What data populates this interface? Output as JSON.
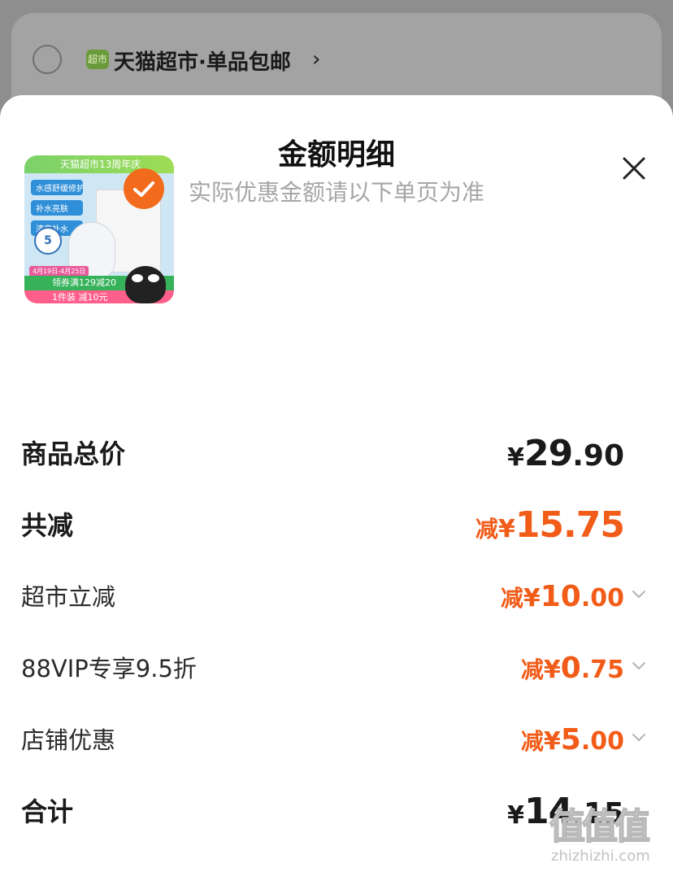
{
  "store": {
    "logo_text": "超市",
    "name": "天猫超市·单品包邮",
    "chevron": "›"
  },
  "sheet": {
    "title": "金额明细",
    "subtitle": "实际优惠金额请以下单页为准",
    "close_icon": "close-icon"
  },
  "product": {
    "banner": "天猫超市13周年庆",
    "tags": [
      "水感舒缓修护",
      "补水亮肤",
      "清爽补水"
    ],
    "pack_count": "5",
    "date": "4月19日-4月25日",
    "promo1": "领券满129减20",
    "promo2": "1件装 减10元",
    "selected": true
  },
  "price_rows": [
    {
      "label": "商品总价",
      "prefix": "",
      "yen": "¥",
      "int": "29",
      "dec": ".90",
      "style": "total"
    },
    {
      "label": "共减",
      "prefix": "减",
      "yen": "¥",
      "int": "15",
      "dec": ".75",
      "style": "total-discount"
    },
    {
      "label": "超市立减",
      "prefix": "减",
      "yen": "¥",
      "int": "10",
      "dec": ".00",
      "style": "discount",
      "expandable": true
    },
    {
      "label": "88VIP专享9.5折",
      "prefix": "减",
      "yen": "¥",
      "int": "0",
      "dec": ".75",
      "style": "discount",
      "expandable": true
    },
    {
      "label": "店铺优惠",
      "prefix": "减",
      "yen": "¥",
      "int": "5",
      "dec": ".00",
      "style": "discount",
      "expandable": true
    },
    {
      "label": "合计",
      "prefix": "",
      "yen": "¥",
      "int": "14",
      "dec": ".15",
      "style": "total"
    }
  ],
  "watermark": {
    "logo": "值值值",
    "url": "zhizhizhi.com"
  },
  "colors": {
    "accent": "#f25c19",
    "overlay": "#8e8e8e",
    "subtitle": "#a6a6a6"
  }
}
